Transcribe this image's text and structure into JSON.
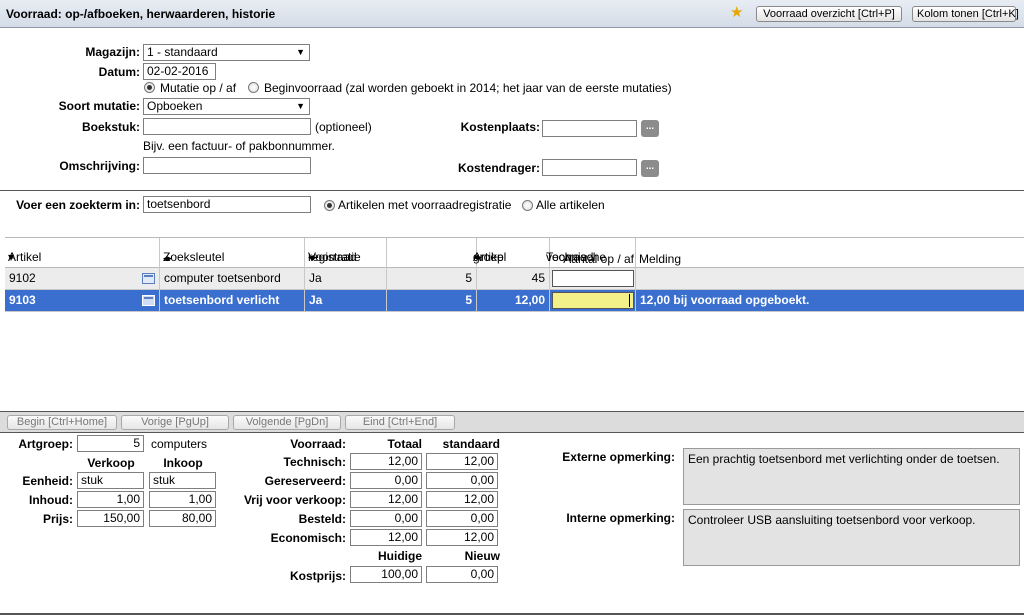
{
  "header": {
    "title": "Voorraad: op-/afboeken, herwaarderen, historie",
    "btn_overview": "Voorraad overzicht [Ctrl+P]",
    "btn_columns": "Kolom tonen [Ctrl+K]"
  },
  "form": {
    "magazijn_label": "Magazijn:",
    "magazijn_value": "1 - standaard",
    "datum_label": "Datum:",
    "datum_value": "02-02-2016",
    "radio_mutatie": "Mutatie op / af",
    "radio_begin": "Beginvoorraad (zal worden geboekt in 2014; het jaar van de eerste mutaties)",
    "soort_label": "Soort mutatie:",
    "soort_value": "Opboeken",
    "boekstuk_label": "Boekstuk:",
    "boekstuk_value": "",
    "boekstuk_hint": "(optioneel)",
    "boekstuk_help": "Bijv. een factuur- of pakbonnummer.",
    "omschrijving_label": "Omschrijving:",
    "omschrijving_value": "",
    "kostenplaats_label": "Kostenplaats:",
    "kostenplaats_value": "",
    "kostendrager_label": "Kostendrager:",
    "kostendrager_value": "",
    "lookup_btn": "..."
  },
  "search": {
    "label": "Voer een zoekterm in:",
    "value": "toetsenbord",
    "opt_registered": "Artikelen met voorraadregistratie",
    "opt_all": "Alle artikelen"
  },
  "grid": {
    "headers": {
      "artikel": "Artikel",
      "zoeksleutel": "Zoeksleutel",
      "voorraad1": "Voorraad",
      "voorraad2": "registratie",
      "groep1": "Artikel",
      "groep2": "groep",
      "tech1": "Technische",
      "tech2": "voorraad",
      "aantal": "Aantal op / af",
      "melding": "Melding"
    },
    "rows": [
      {
        "artikel": "9102",
        "zoeksleutel": "computer toetsenbord",
        "registratie": "Ja",
        "groep": "5",
        "voorraad": "45",
        "aantal": "",
        "melding": ""
      },
      {
        "artikel": "9103",
        "zoeksleutel": "toetsenbord verlicht",
        "registratie": "Ja",
        "groep": "5",
        "voorraad": "12,00",
        "aantal": "",
        "melding": "12,00 bij voorraad opgeboekt."
      }
    ]
  },
  "nav": {
    "begin": "Begin [Ctrl+Home]",
    "prev": "Vorige [PgUp]",
    "next": "Volgende [PgDn]",
    "end": "Eind [Ctrl+End]"
  },
  "detail": {
    "artgroep_label": "Artgroep:",
    "artgroep_value": "5",
    "artgroep_name": "computers",
    "verkoop": "Verkoop",
    "inkoop": "Inkoop",
    "eenheid_label": "Eenheid:",
    "eenheid_verkoop": "stuk",
    "eenheid_inkoop": "stuk",
    "inhoud_label": "Inhoud:",
    "inhoud_verkoop": "1,00",
    "inhoud_inkoop": "1,00",
    "prijs_label": "Prijs:",
    "prijs_verkoop": "150,00",
    "prijs_inkoop": "80,00"
  },
  "stock": {
    "voorraad_label": "Voorraad:",
    "col_totaal": "Totaal",
    "col_standaard": "standaard",
    "rows": [
      {
        "label": "Technisch:",
        "totaal": "12,00",
        "standaard": "12,00"
      },
      {
        "label": "Gereserveerd:",
        "totaal": "0,00",
        "standaard": "0,00"
      },
      {
        "label": "Vrij voor verkoop:",
        "totaal": "12,00",
        "standaard": "12,00"
      },
      {
        "label": "Besteld:",
        "totaal": "0,00",
        "standaard": "0,00"
      },
      {
        "label": "Economisch:",
        "totaal": "12,00",
        "standaard": "12,00"
      }
    ],
    "col_huidige": "Huidige",
    "col_nieuw": "Nieuw",
    "kostprijs_label": "Kostprijs:",
    "kostprijs_huidige": "100,00",
    "kostprijs_nieuw": "0,00"
  },
  "remarks": {
    "extern_label": "Externe opmerking:",
    "extern_text": "Een prachtig toetsenbord met verlichting onder de toetsen.",
    "intern_label": "Interne opmerking:",
    "intern_text": "Controleer USB aansluiting toetsenbord voor verkoop."
  },
  "colors": {
    "selected_row": "#3a6fcf",
    "edit_cell": "#f3f08a",
    "star": "#e6a700"
  }
}
